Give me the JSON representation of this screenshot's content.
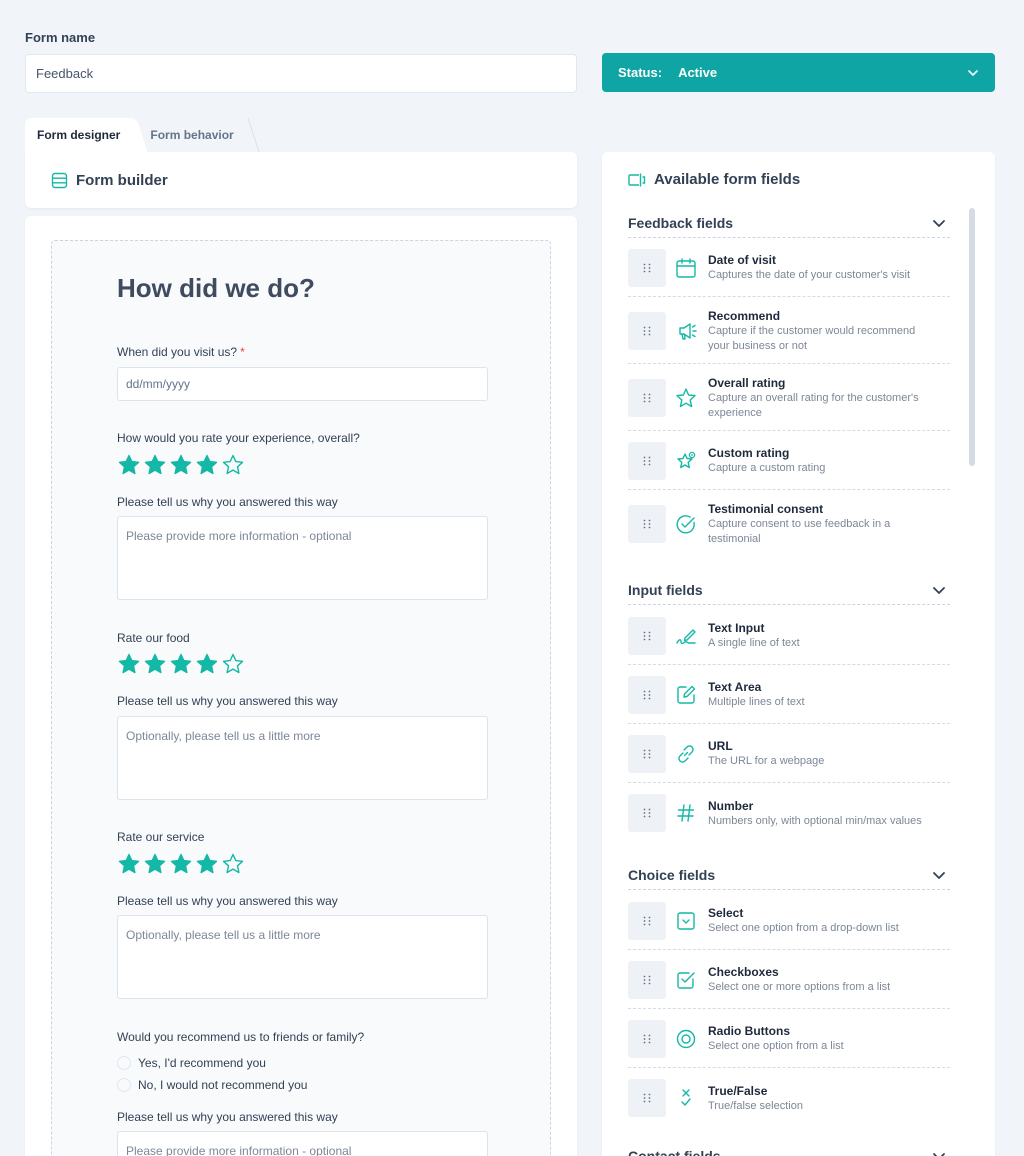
{
  "form_name": {
    "label": "Form name",
    "value": "Feedback"
  },
  "status": {
    "label": "Status:",
    "value": "Active"
  },
  "tabs": [
    {
      "label": "Form designer",
      "active": true
    },
    {
      "label": "Form behavior",
      "active": false
    }
  ],
  "builder": {
    "title": "Form builder",
    "form_title": "How did we do?",
    "q_visit": {
      "label": "When did you visit us?",
      "required_mark": "*",
      "placeholder": "dd/mm/yyyy"
    },
    "q_overall": {
      "label": "How would you rate your experience, overall?",
      "stars_filled": 4,
      "stars_total": 5
    },
    "q_overall_why": {
      "label": "Please tell us why you answered this way",
      "placeholder": "Please provide more information - optional"
    },
    "q_food": {
      "label": "Rate our food",
      "stars_filled": 4,
      "stars_total": 5
    },
    "q_food_why": {
      "label": "Please tell us why you answered this way",
      "placeholder": "Optionally, please tell us a little more"
    },
    "q_service": {
      "label": "Rate our service",
      "stars_filled": 4,
      "stars_total": 5
    },
    "q_service_why": {
      "label": "Please tell us why you answered this way",
      "placeholder": "Optionally, please tell us a little more"
    },
    "q_recommend": {
      "label": "Would you recommend us to friends or family?",
      "options": [
        "Yes, I'd recommend you",
        "No, I would not recommend you"
      ]
    },
    "q_recommend_why": {
      "label": "Please tell us why you answered this way",
      "placeholder": "Please provide more information - optional"
    }
  },
  "panel": {
    "title": "Available form fields",
    "sections": {
      "feedback": {
        "title": "Feedback fields",
        "fields": [
          {
            "name": "Date of visit",
            "desc": "Captures the date of your customer's visit",
            "icon": "calendar-icon"
          },
          {
            "name": "Recommend",
            "desc": "Capture if the customer would recommend",
            "desc2": "your business or not",
            "icon": "megaphone-icon"
          },
          {
            "name": "Overall rating",
            "desc": "Capture an overall rating for the customer's",
            "desc2": "experience",
            "icon": "star-icon"
          },
          {
            "name": "Custom rating",
            "desc": "Capture a custom rating",
            "icon": "star-gear-icon"
          },
          {
            "name": "Testimonial consent",
            "desc": "Capture consent to use feedback in a",
            "desc2": "testimonial",
            "icon": "check-circle-icon"
          }
        ]
      },
      "input": {
        "title": "Input fields",
        "fields": [
          {
            "name": "Text Input",
            "desc": "A single line of text",
            "icon": "pen-signature-icon"
          },
          {
            "name": "Text Area",
            "desc": "Multiple lines of text",
            "icon": "edit-icon"
          },
          {
            "name": "URL",
            "desc": "The URL for a webpage",
            "icon": "link-icon"
          },
          {
            "name": "Number",
            "desc": "Numbers only, with optional min/max values",
            "icon": "hash-icon"
          }
        ]
      },
      "choice": {
        "title": "Choice fields",
        "fields": [
          {
            "name": "Select",
            "desc": "Select one option from a drop-down list",
            "icon": "select-icon"
          },
          {
            "name": "Checkboxes",
            "desc": "Select one or more options from a list",
            "icon": "checkbox-icon"
          },
          {
            "name": "Radio Buttons",
            "desc": "Select one option from a list",
            "icon": "radio-icon"
          },
          {
            "name": "True/False",
            "desc": "True/false selection",
            "icon": "true-false-icon"
          }
        ]
      },
      "contact": {
        "title": "Contact fields"
      }
    }
  },
  "colors": {
    "accent": "#0ea5a4",
    "star": "#14b8a6"
  }
}
